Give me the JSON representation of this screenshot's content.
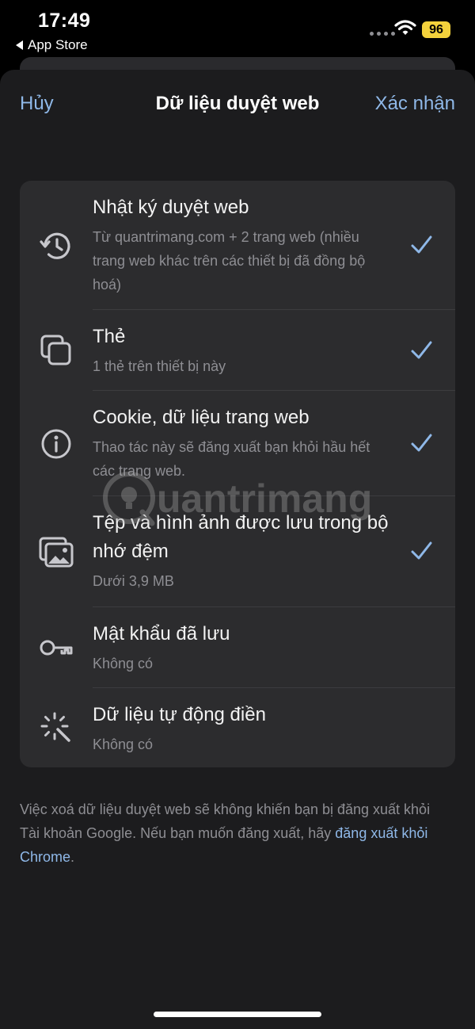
{
  "status_bar": {
    "time": "17:49",
    "back_app": "App Store",
    "battery": "96",
    "battery_color": "#f4d23c"
  },
  "nav": {
    "cancel": "Hủy",
    "title": "Dữ liệu duyệt web",
    "confirm": "Xác nhận"
  },
  "items": [
    {
      "icon": "history-icon",
      "title": "Nhật ký duyệt web",
      "subtitle": "Từ quantrimang.com + 2 trang web (nhiều trang web khác trên các thiết bị đã đồng bộ hoá)",
      "checked": true
    },
    {
      "icon": "tabs-icon",
      "title": "Thẻ",
      "subtitle": "1 thẻ trên thiết bị này",
      "checked": true
    },
    {
      "icon": "info-icon",
      "title": "Cookie, dữ liệu trang web",
      "subtitle": "Thao tác này sẽ đăng xuất bạn khỏi hầu hết các trang web.",
      "checked": true
    },
    {
      "icon": "images-icon",
      "title": "Tệp và hình ảnh được lưu trong bộ nhớ đệm",
      "subtitle": "Dưới 3,9 MB",
      "checked": true
    },
    {
      "icon": "key-icon",
      "title": "Mật khẩu đã lưu",
      "subtitle": "Không có",
      "checked": false
    },
    {
      "icon": "magic-wand-icon",
      "title": "Dữ liệu tự động điền",
      "subtitle": "Không có",
      "checked": false
    }
  ],
  "footer": {
    "text": "Việc xoá dữ liệu duyệt web sẽ không khiến bạn bị đăng xuất khỏi Tài khoản Google. Nếu bạn muốn đăng xuất, hãy ",
    "link": "đăng xuất khỏi Chrome",
    "end": "."
  },
  "watermark": "uantrimang",
  "accent_color": "#8fb8e8"
}
